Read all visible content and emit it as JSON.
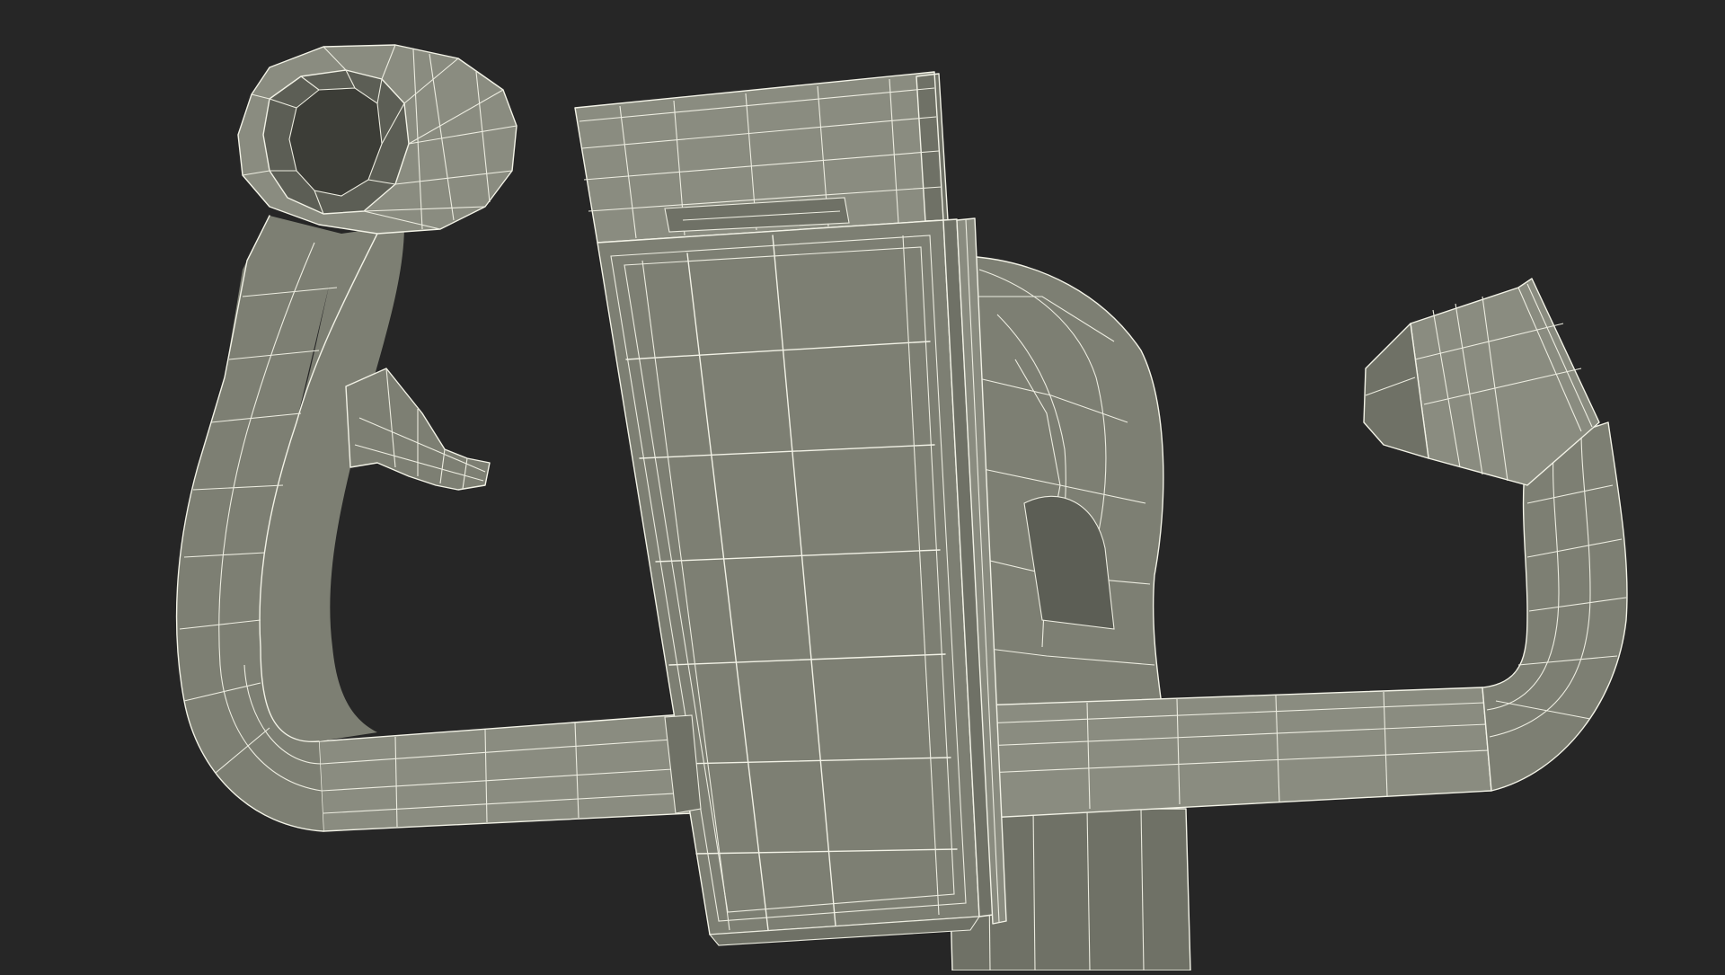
{
  "scene": {
    "background_color": "#262626",
    "mesh_fill_color": "#7d7f73",
    "wireframe_color": "#f2f2e6",
    "objects": [
      "handlebar-frame",
      "left-grip-ring",
      "right-grip-handle",
      "control-box",
      "control-box-lid",
      "throttle-nozzle",
      "support-post"
    ]
  }
}
